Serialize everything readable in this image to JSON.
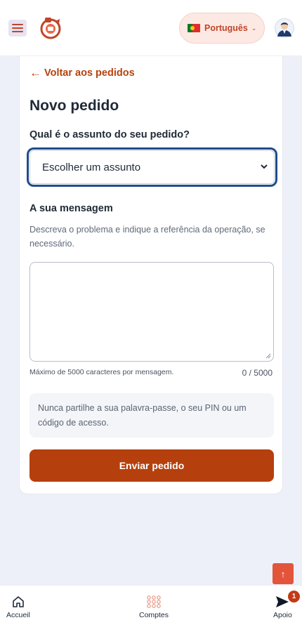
{
  "header": {
    "menu_icon": "hamburger-icon",
    "logo_icon": "brand-logo",
    "language": {
      "flag_icon": "portugal-flag-icon",
      "label": "Português",
      "chevron_icon": "chevron-down-icon"
    },
    "avatar_icon": "user-avatar-icon"
  },
  "form": {
    "back_link": "Voltar aos pedidos",
    "title": "Novo pedido",
    "subject_label": "Qual é o assunto do seu pedido?",
    "subject_select_value": "Escolher um assunto",
    "message_label": "A sua mensagem",
    "message_description": "Descreva o problema e indique a referência da operação, se necessário.",
    "message_value": "",
    "max_chars_note": "Máximo de 5000 caracteres por mensagem.",
    "char_counter": "0 / 5000",
    "security_notice": "Nunca partilhe a sua palavra-passe, o seu PIN ou um código de acesso.",
    "submit_label": "Enviar pedido"
  },
  "scroll_top": {
    "label": "↑"
  },
  "bottom_nav": {
    "items": [
      {
        "label": "Accueil",
        "icon": "home-icon"
      },
      {
        "label": "Comptes",
        "icon": "grid-icon"
      },
      {
        "label": "Apoio",
        "icon": "send-icon",
        "badge": "1"
      }
    ]
  },
  "colors": {
    "brand": "#b5400d",
    "focus_ring": "#1f4d88",
    "background": "#eef0f9"
  }
}
